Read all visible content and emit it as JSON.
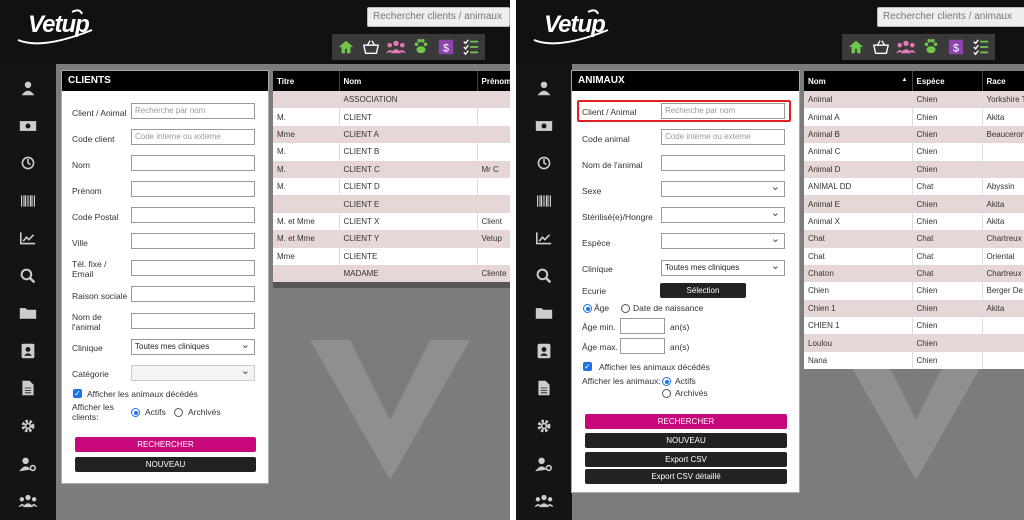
{
  "app": {
    "logo_text": "Vetup",
    "search_placeholder": "Rechercher clients / animaux"
  },
  "toolbar_icons": [
    "home-icon",
    "basket-icon",
    "users-icon",
    "paw-icon",
    "dollar-icon",
    "checklist-icon"
  ],
  "sidebar_icons": [
    "user-icon",
    "cash-icon",
    "history-icon",
    "barcode-icon",
    "chart-icon",
    "search-icon",
    "folder-icon",
    "contact-icon",
    "document-icon",
    "gear-icon",
    "user-gear-icon",
    "group-icon"
  ],
  "colors": {
    "accent": "#c7077a",
    "header": "#111111",
    "row_alt": "#e6d6d6",
    "toolbar_icon": "#6ec64a"
  },
  "clients": {
    "title": "CLIENTS",
    "client_animal": {
      "label": "Client / Animal",
      "placeholder": "Recherche par nom"
    },
    "code_client": {
      "label": "Code client",
      "placeholder": "Code interne ou externe"
    },
    "nom": {
      "label": "Nom"
    },
    "prenom": {
      "label": "Prénom"
    },
    "code_postal": {
      "label": "Code Postal"
    },
    "ville": {
      "label": "Ville"
    },
    "tel": {
      "label": "Tél. fixe / Email"
    },
    "raison_sociale": {
      "label": "Raison sociale"
    },
    "nom_animal": {
      "label": "Nom de l'animal"
    },
    "clinique": {
      "label": "Clinique",
      "value": "Toutes mes cliniques"
    },
    "categorie": {
      "label": "Catégorie",
      "value": ""
    },
    "deceased": {
      "label": "Afficher les animaux décédés",
      "checked": true
    },
    "show_clients": {
      "label": "Afficher les clients:",
      "opt1": "Actifs",
      "opt2": "Archivés",
      "selected": "Actifs"
    },
    "search_btn": "RECHERCHER",
    "new_btn": "NOUVEAU"
  },
  "clients_table": {
    "columns": [
      "Titre",
      "Nom",
      "Prénom"
    ],
    "rows": [
      [
        "",
        "ASSOCIATION",
        ""
      ],
      [
        "M.",
        "CLIENT",
        ""
      ],
      [
        "Mme",
        "CLIENT A",
        ""
      ],
      [
        "M.",
        "CLIENT B",
        ""
      ],
      [
        "M.",
        "CLIENT C",
        "Mr C"
      ],
      [
        "M.",
        "CLIENT D",
        ""
      ],
      [
        "",
        "CLIENT E",
        ""
      ],
      [
        "M. et Mme",
        "CLIENT X",
        "Client"
      ],
      [
        "M. et Mme",
        "CLIENT Y",
        "Vetup"
      ],
      [
        "Mme",
        "CLIENTE",
        ""
      ],
      [
        "",
        "MADAME",
        "Cliente"
      ]
    ]
  },
  "animaux": {
    "title": "ANIMAUX",
    "client_animal": {
      "label": "Client / Animal",
      "placeholder": "Recherche par nom"
    },
    "code_animal": {
      "label": "Code animal",
      "placeholder": "Code interne ou externe"
    },
    "nom_animal": {
      "label": "Nom de l'animal"
    },
    "sexe": {
      "label": "Sexe",
      "value": ""
    },
    "sterilise": {
      "label": "Stérilisé(e)/Hongre",
      "value": ""
    },
    "espece": {
      "label": "Espèce",
      "value": ""
    },
    "clinique": {
      "label": "Clinique",
      "value": "Toutes mes cliniques"
    },
    "ecurie": {
      "label": "Ecurie",
      "button": "Sélection"
    },
    "age_mode": {
      "opt1": "Âge",
      "opt2": "Date de naissance",
      "selected": "Âge"
    },
    "age_min": {
      "label": "Âge min.",
      "unit": "an(s)"
    },
    "age_max": {
      "label": "Âge max.",
      "unit": "an(s)"
    },
    "deceased": {
      "label": "Afficher les animaux décédés",
      "checked": true
    },
    "show_animals": {
      "label": "Afficher les animaux:",
      "opt1": "Actifs",
      "opt2": "Archivés",
      "selected": "Actifs"
    },
    "search_btn": "RECHERCHER",
    "new_btn": "NOUVEAU",
    "export_btn": "Export CSV",
    "export_detail_btn": "Export CSV détaillé"
  },
  "animals_table": {
    "columns": [
      "Nom",
      "Espèce",
      "Race"
    ],
    "rows": [
      [
        "Animal",
        "Chien",
        "Yorkshire T"
      ],
      [
        "Animal A",
        "Chien",
        "Akita"
      ],
      [
        "Animal B",
        "Chien",
        "Beauceron"
      ],
      [
        "Animal C",
        "Chien",
        ""
      ],
      [
        "Animal D",
        "Chien",
        ""
      ],
      [
        "ANIMAL DD",
        "Chat",
        "Abyssin"
      ],
      [
        "Animal E",
        "Chien",
        "Akita"
      ],
      [
        "Animal X",
        "Chien",
        "Akita"
      ],
      [
        "Chat",
        "Chat",
        "Chartreux"
      ],
      [
        "Chat",
        "Chat",
        "Oriental"
      ],
      [
        "Chaton",
        "Chat",
        "Chartreux"
      ],
      [
        "Chien",
        "Chien",
        "Berger De"
      ],
      [
        "Chien 1",
        "Chien",
        "Akita"
      ],
      [
        "CHIEN 1",
        "Chien",
        ""
      ],
      [
        "Loulou",
        "Chien",
        ""
      ],
      [
        "Nana",
        "Chien",
        ""
      ]
    ]
  }
}
